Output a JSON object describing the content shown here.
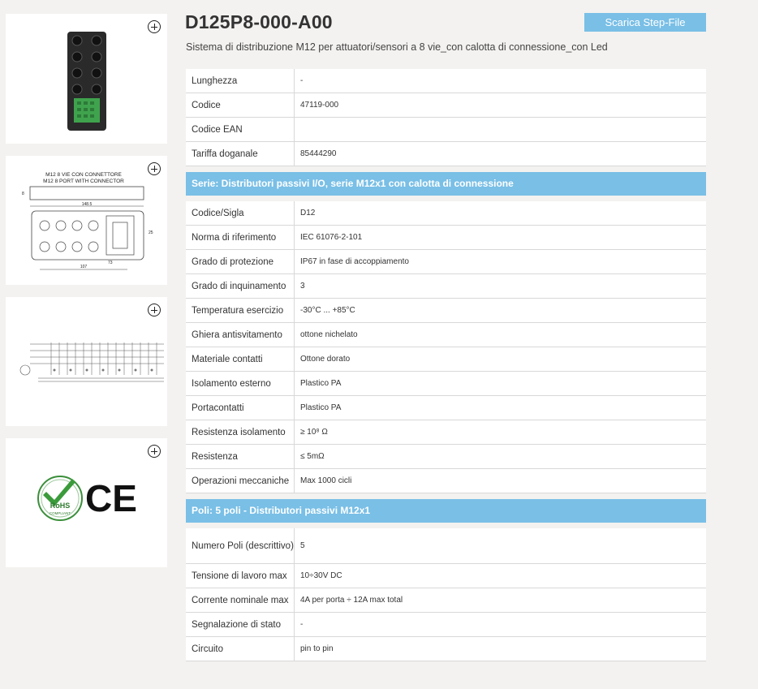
{
  "product": {
    "title": "D125P8-000-A00",
    "subtitle": "Sistema di distribuzione M12 per attuatori/sensori a 8 vie_con calotta di connessione_con Led",
    "download_label": "Scarica Step-File"
  },
  "thumbs": {
    "drawing_label_it": "M12 8 VIE CON CONNETTORE",
    "drawing_label_en": "M12 8 PORT WITH CONNECTOR",
    "dim_a": "148.5",
    "dim_b": "107",
    "dim_c": "73",
    "dim_d": "8",
    "dim_e": "25",
    "rohs_main": "RoHS",
    "rohs_sub": "COMPLIANT",
    "ce": "CE"
  },
  "general": [
    {
      "k": "Lunghezza",
      "v": "-"
    },
    {
      "k": "Codice",
      "v": "47119-000"
    },
    {
      "k": "Codice EAN",
      "v": ""
    },
    {
      "k": "Tariffa doganale",
      "v": "85444290"
    }
  ],
  "series": {
    "title": "Serie: Distributori passivi I/O, serie M12x1 con calotta di connessione",
    "rows": [
      {
        "k": "Codice/Sigla",
        "v": "D12"
      },
      {
        "k": "Norma di riferimento",
        "v": "IEC 61076-2-101"
      },
      {
        "k": "Grado di protezione",
        "v": "IP67 in fase di accoppiamento"
      },
      {
        "k": "Grado di inquinamento",
        "v": "3"
      },
      {
        "k": "Temperatura esercizio",
        "v": "-30°C ... +85°C"
      },
      {
        "k": "Ghiera antisvitamento",
        "v": "ottone nichelato"
      },
      {
        "k": "Materiale contatti",
        "v": "Ottone dorato"
      },
      {
        "k": "Isolamento esterno",
        "v": "Plastico PA"
      },
      {
        "k": "Portacontatti",
        "v": "Plastico PA"
      },
      {
        "k": "Resistenza isolamento",
        "v": "≥ 10⁸ Ω"
      },
      {
        "k": "Resistenza",
        "v": "≤ 5mΩ"
      },
      {
        "k": "Operazioni meccaniche",
        "v": "Max 1000 cicli"
      }
    ]
  },
  "poles": {
    "title": "Poli: 5 poli - Distributori passivi M12x1",
    "rows": [
      {
        "k": "Numero Poli (descrittivo)",
        "v": "5"
      },
      {
        "k": "Tensione di lavoro max",
        "v": "10÷30V DC"
      },
      {
        "k": "Corrente nominale max",
        "v": "4A per porta ÷ 12A max total"
      },
      {
        "k": "Segnalazione di stato",
        "v": "-"
      },
      {
        "k": "Circuito",
        "v": "pin to pin"
      }
    ]
  }
}
